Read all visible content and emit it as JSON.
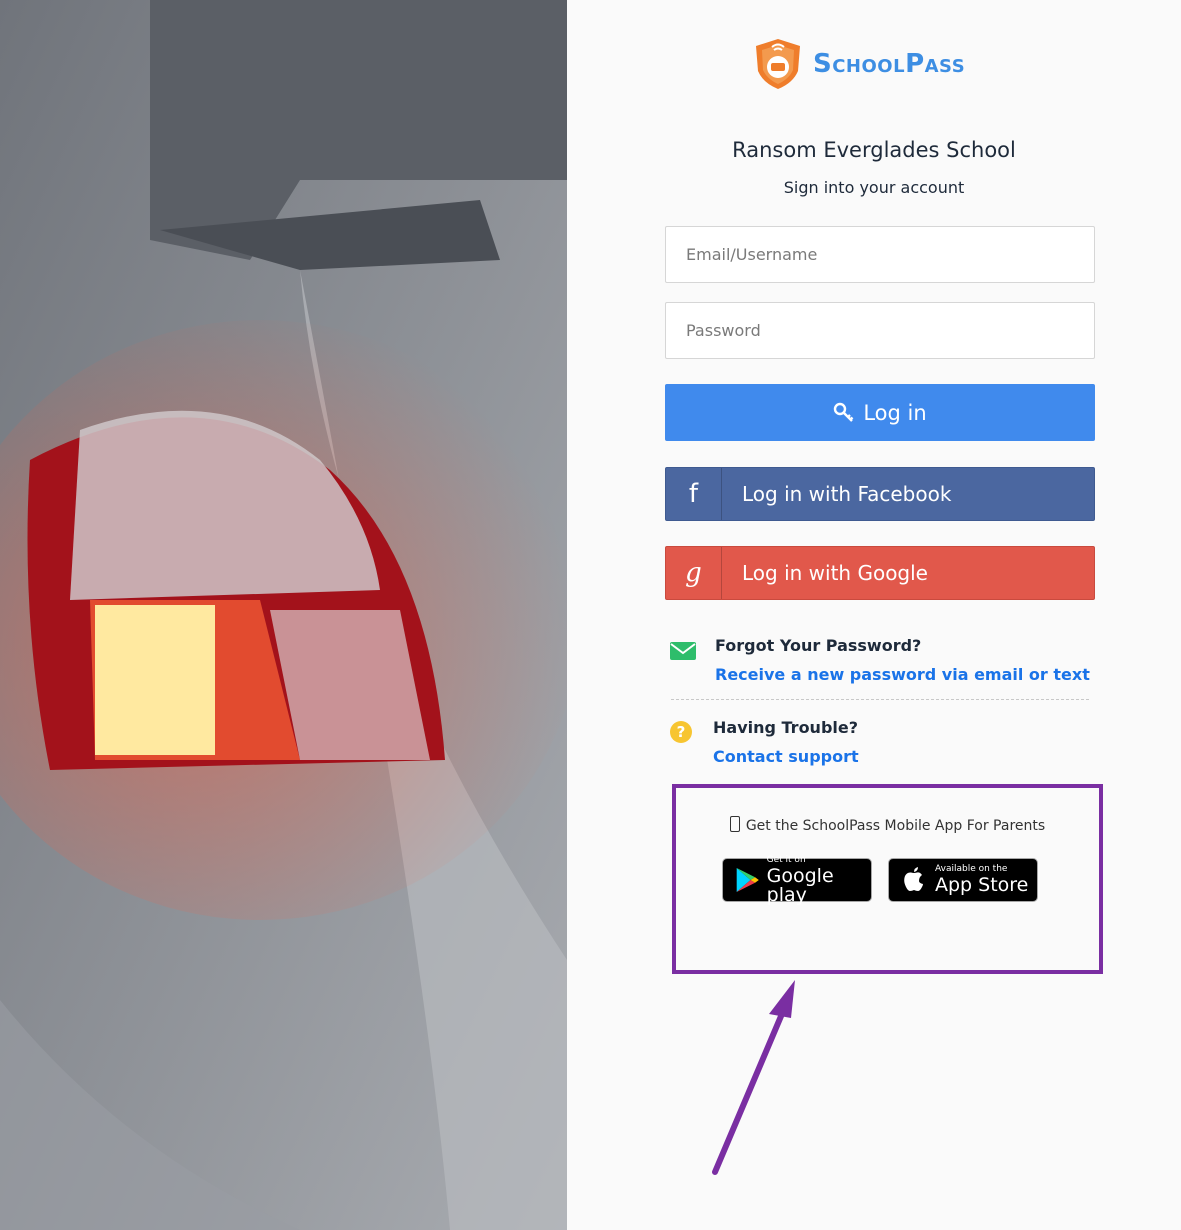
{
  "brand": {
    "name": "SchoolPass",
    "color": "#3d8ee3",
    "shield_color": "#ef7d2b"
  },
  "school_name": "Ransom Everglades School",
  "subtitle": "Sign into your account",
  "form": {
    "email_placeholder": "Email/Username",
    "password_placeholder": "Password",
    "login_label": "Log in"
  },
  "social": {
    "facebook_label": "Log in with Facebook",
    "google_label": "Log in with Google",
    "facebook_icon": "f",
    "google_icon": "g"
  },
  "help": {
    "forgot_title": "Forgot Your Password?",
    "forgot_link": "Receive a new password via email or text",
    "trouble_title": "Having Trouble?",
    "trouble_link": "Contact support"
  },
  "apps": {
    "title": "Get the SchoolPass Mobile App For Parents",
    "google_small": "Get it on",
    "google_big": "Google play",
    "apple_small": "Available on the",
    "apple_big": "App Store"
  },
  "colors": {
    "login_button": "#408aed",
    "facebook": "#4b67a0",
    "google": "#e1584b",
    "link": "#1a73e8",
    "highlight_box": "#7a2ea2"
  }
}
